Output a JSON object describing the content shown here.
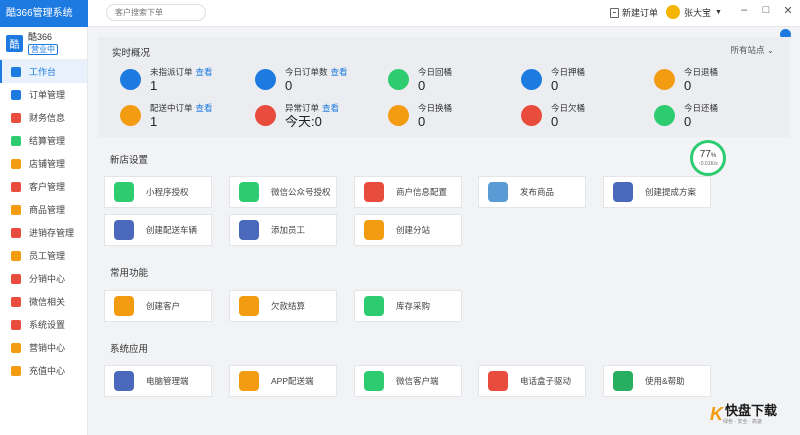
{
  "app": {
    "title": "酷366管理系统"
  },
  "store": {
    "name": "酷366",
    "status": "营业中",
    "logo": "酷"
  },
  "nav": [
    {
      "label": "工作台",
      "icon": "dashboard-icon",
      "color": "#1d7ae0",
      "active": true
    },
    {
      "label": "订单管理",
      "icon": "order-icon",
      "color": "#1d7ae0"
    },
    {
      "label": "财务信息",
      "icon": "finance-icon",
      "color": "#e74c3c"
    },
    {
      "label": "结算管理",
      "icon": "settlement-icon",
      "color": "#2ecc71"
    },
    {
      "label": "店铺管理",
      "icon": "shop-icon",
      "color": "#f39c12"
    },
    {
      "label": "客户管理",
      "icon": "customer-icon",
      "color": "#e74c3c"
    },
    {
      "label": "商品管理",
      "icon": "goods-icon",
      "color": "#f39c12"
    },
    {
      "label": "进销存管理",
      "icon": "inventory-icon",
      "color": "#e74c3c"
    },
    {
      "label": "员工管理",
      "icon": "staff-icon",
      "color": "#f39c12"
    },
    {
      "label": "分销中心",
      "icon": "distribution-icon",
      "color": "#e74c3c"
    },
    {
      "label": "微信相关",
      "icon": "wechat-icon",
      "color": "#e74c3c"
    },
    {
      "label": "系统设置",
      "icon": "settings-icon",
      "color": "#e74c3c"
    },
    {
      "label": "营销中心",
      "icon": "marketing-icon",
      "color": "#f39c12"
    },
    {
      "label": "充值中心",
      "icon": "recharge-icon",
      "color": "#f39c12"
    }
  ],
  "topbar": {
    "search_placeholder": "客户搜索下单",
    "new_order": "新建订单",
    "user_name": "张大宝",
    "minimize": "–",
    "maximize": "□",
    "close": "✕"
  },
  "overview": {
    "title": "实时概况",
    "filter": "所有站点",
    "link": "查看",
    "stats": [
      {
        "label": "未指派订单",
        "value": "1",
        "link": true,
        "icon": "clipboard-icon",
        "color": "#1d7ae0"
      },
      {
        "label": "今日订单数",
        "value": "0",
        "link": true,
        "icon": "order-icon",
        "color": "#1d7ae0"
      },
      {
        "label": "今日回桶",
        "value": "0",
        "icon": "recycle-icon",
        "color": "#2ecc71"
      },
      {
        "label": "今日押桶",
        "value": "0",
        "icon": "deposit-icon",
        "color": "#1d7ae0"
      },
      {
        "label": "今日退桶",
        "value": "0",
        "icon": "return-icon",
        "color": "#f39c12"
      },
      {
        "label": "配送中订单",
        "value": "1",
        "link": true,
        "icon": "truck-icon",
        "color": "#f39c12"
      },
      {
        "label": "异常订单",
        "value": "今天:0",
        "link": true,
        "icon": "warning-icon",
        "color": "#e74c3c"
      },
      {
        "label": "今日换桶",
        "value": "0",
        "icon": "swap-icon",
        "color": "#f39c12"
      },
      {
        "label": "今日欠桶",
        "value": "0",
        "icon": "debt-icon",
        "color": "#e74c3c"
      },
      {
        "label": "今日还桶",
        "value": "0",
        "icon": "undo-icon",
        "color": "#2ecc71"
      }
    ]
  },
  "gauge": {
    "percent": "77",
    "percent_sign": "%",
    "speed": "↑0.01K/s",
    "level": 0.77
  },
  "sections": [
    {
      "title": "新店设置",
      "cards": [
        {
          "label": "小程序授权",
          "icon": "mini-program-icon",
          "color": "#2ecc71"
        },
        {
          "label": "微信公众号授权",
          "icon": "wechat-icon",
          "color": "#2ecc71"
        },
        {
          "label": "商户信息配置",
          "icon": "gear-icon",
          "color": "#e74c3c"
        },
        {
          "label": "发布商品",
          "icon": "bag-icon",
          "color": "#5b9bd5"
        },
        {
          "label": "创建提成方案",
          "icon": "wallet-icon",
          "color": "#4a69bd"
        },
        {
          "label": "创建配送车辆",
          "icon": "truck-icon",
          "color": "#4a69bd"
        },
        {
          "label": "添加员工",
          "icon": "person-icon",
          "color": "#4a69bd"
        },
        {
          "label": "创建分站",
          "icon": "branch-icon",
          "color": "#f39c12"
        }
      ]
    },
    {
      "title": "常用功能",
      "cards": [
        {
          "label": "创建客户",
          "icon": "customer-card-icon",
          "color": "#f39c12"
        },
        {
          "label": "欠款结算",
          "icon": "money-icon",
          "color": "#f39c12"
        },
        {
          "label": "库存采购",
          "icon": "purchase-icon",
          "color": "#2ecc71"
        }
      ]
    },
    {
      "title": "系统应用",
      "cards": [
        {
          "label": "电脑管理端",
          "icon": "windows-icon",
          "color": "#4a69bd"
        },
        {
          "label": "APP配送端",
          "icon": "android-icon",
          "color": "#f39c12"
        },
        {
          "label": "微信客户端",
          "icon": "mini-program-icon",
          "color": "#2ecc71"
        },
        {
          "label": "电话盒子驱动",
          "icon": "phone-box-icon",
          "color": "#e74c3c"
        },
        {
          "label": "使用&帮助",
          "icon": "help-icon",
          "color": "#27ae60"
        }
      ]
    }
  ],
  "watermark": {
    "k": "K",
    "name": "快盘下载",
    "sub": "绿色 · 安全 · 高速"
  }
}
